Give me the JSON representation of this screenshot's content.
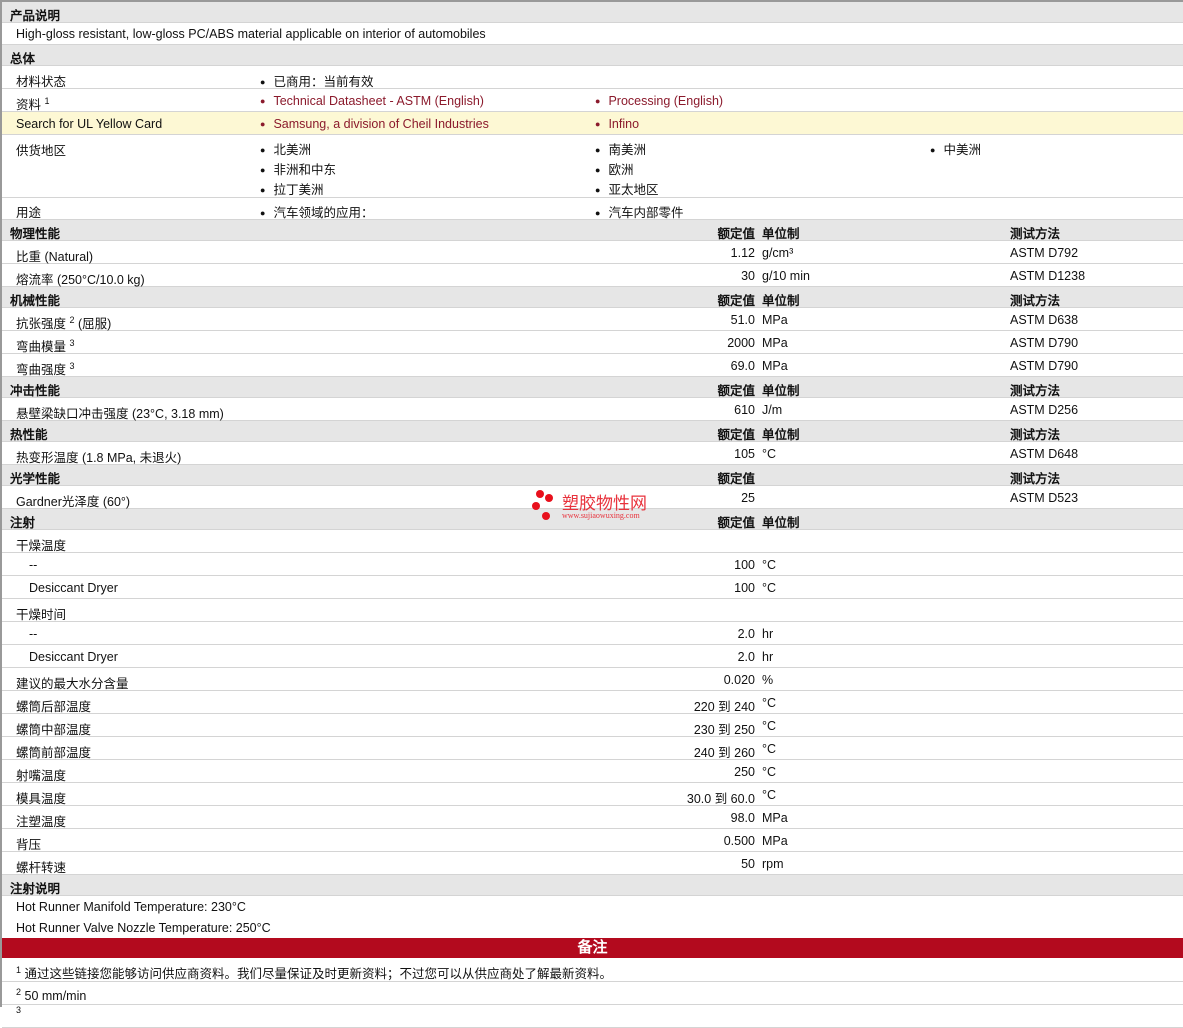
{
  "product_desc": {
    "title": "产品说明",
    "text": "High-gloss resistant, low-gloss PC/ABS material applicable on interior of automobiles"
  },
  "general": {
    "title": "总体",
    "status": {
      "label": "材料状态",
      "items": [
        "已商用：当前有效"
      ]
    },
    "docs": {
      "label": "资料",
      "sup": "1",
      "items": [
        "Technical Datasheet - ASTM (English)",
        "Processing (English)"
      ]
    },
    "ul": {
      "label": "Search for UL Yellow Card",
      "items": [
        "Samsung, a division of Cheil Industries",
        "Infino"
      ]
    },
    "regions": {
      "label": "供货地区",
      "items": [
        "北美洲",
        "南美洲",
        "中美洲",
        "非洲和中东",
        "欧洲",
        "拉丁美洲",
        "亚太地区"
      ]
    },
    "uses": {
      "label": "用途",
      "items": [
        "汽车领域的应用：",
        "汽车内部零件"
      ]
    }
  },
  "headers": {
    "value": "额定值",
    "unit": "单位制",
    "test": "测试方法"
  },
  "sections": [
    {
      "title": "物理性能",
      "cols": [
        "value",
        "unit",
        "test"
      ],
      "rows": [
        {
          "label": "比重  (Natural)",
          "value": "1.12",
          "unit": "g/cm³",
          "test": "ASTM D792"
        },
        {
          "label": "熔流率  (250°C/10.0 kg)",
          "value": "30",
          "unit": "g/10 min",
          "test": "ASTM D1238"
        }
      ]
    },
    {
      "title": "机械性能",
      "cols": [
        "value",
        "unit",
        "test"
      ],
      "rows": [
        {
          "label": "抗张强度",
          "sup": "2",
          "suffix": " (屈服)",
          "value": "51.0",
          "unit": "MPa",
          "test": "ASTM D638"
        },
        {
          "label": "弯曲模量",
          "sup": "3",
          "value": "2000",
          "unit": "MPa",
          "test": "ASTM D790"
        },
        {
          "label": "弯曲强度",
          "sup": "3",
          "value": "69.0",
          "unit": "MPa",
          "test": "ASTM D790"
        }
      ]
    },
    {
      "title": "冲击性能",
      "cols": [
        "value",
        "unit",
        "test"
      ],
      "rows": [
        {
          "label": "悬壁梁缺口冲击强度  (23°C, 3.18 mm)",
          "value": "610",
          "unit": "J/m",
          "test": "ASTM D256"
        }
      ]
    },
    {
      "title": "热性能",
      "cols": [
        "value",
        "unit",
        "test"
      ],
      "rows": [
        {
          "label": "热变形温度  (1.8 MPa, 未退火)",
          "value": "105",
          "unit": "°C",
          "test": "ASTM D648"
        }
      ]
    },
    {
      "title": "光学性能",
      "cols": [
        "value",
        "test"
      ],
      "rows": [
        {
          "label": "Gardner光泽度  (60°)",
          "value": "25",
          "test": "ASTM D523"
        }
      ]
    },
    {
      "title": "注射",
      "cols": [
        "value",
        "unit"
      ],
      "rows": [
        {
          "label": "干燥温度"
        },
        {
          "label": "--",
          "indent": true,
          "value": "100",
          "unit": "°C"
        },
        {
          "label": "Desiccant Dryer",
          "indent": true,
          "value": "100",
          "unit": "°C"
        },
        {
          "label": "干燥时间"
        },
        {
          "label": "--",
          "indent": true,
          "value": "2.0",
          "unit": "hr"
        },
        {
          "label": "Desiccant Dryer",
          "indent": true,
          "value": "2.0",
          "unit": "hr"
        },
        {
          "label": "建议的最大水分含量",
          "value": "0.020",
          "unit": "%"
        },
        {
          "label": "螺筒后部温度",
          "value": "220 到  240",
          "unit": "°C"
        },
        {
          "label": "螺筒中部温度",
          "value": "230 到  250",
          "unit": "°C"
        },
        {
          "label": "螺筒前部温度",
          "value": "240 到  260",
          "unit": "°C"
        },
        {
          "label": "射嘴温度",
          "value": "250",
          "unit": "°C"
        },
        {
          "label": "模具温度",
          "value": "30.0 到  60.0",
          "unit": "°C"
        },
        {
          "label": "注塑温度",
          "value": "98.0",
          "unit": "MPa"
        },
        {
          "label": "背压",
          "value": "0.500",
          "unit": "MPa"
        },
        {
          "label": "螺杆转速",
          "value": "50",
          "unit": "rpm"
        }
      ]
    }
  ],
  "injection_notes": {
    "title": "注射说明",
    "lines": [
      "Hot Runner Manifold Temperature: 230°C",
      "Hot Runner Valve Nozzle Temperature: 250°C"
    ]
  },
  "remarks": {
    "title": "备注",
    "notes": [
      {
        "sup": "1",
        "text": "通过这些链接您能够访问供应商资料。我们尽量保证及时更新资料；不过您可以从供应商处了解最新资料。"
      },
      {
        "sup": "2",
        "text": "50 mm/min"
      },
      {
        "sup": "3",
        "text": ""
      }
    ]
  },
  "watermark": {
    "name": "塑胶物性网",
    "url": "www.sujiaowuxing.com"
  }
}
